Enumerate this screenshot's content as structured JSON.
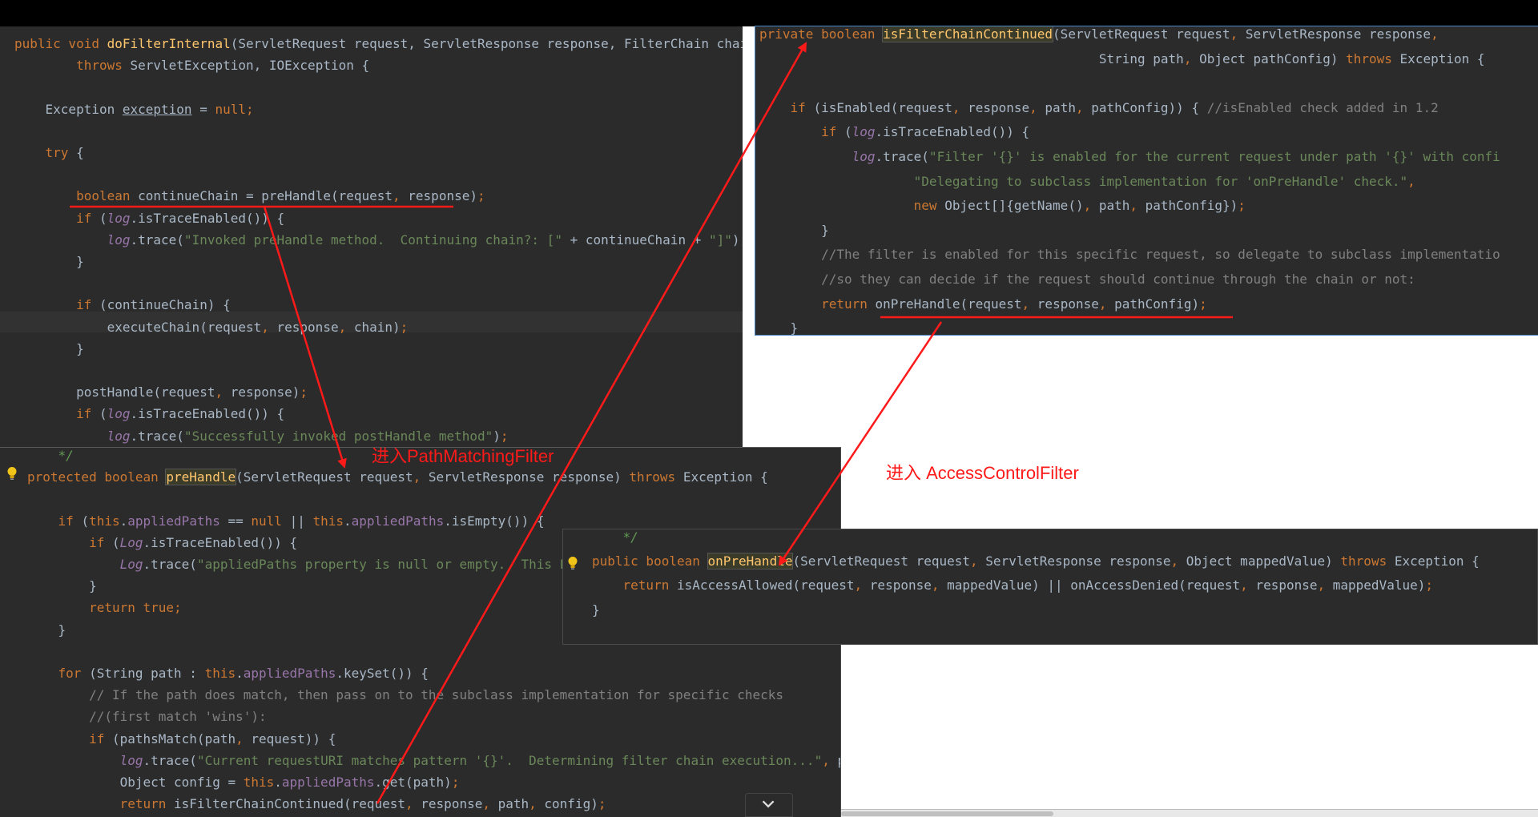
{
  "panel_a": {
    "lines": [
      [
        [
          "kw",
          "public void "
        ],
        [
          "fn",
          "doFilterInternal"
        ],
        [
          "",
          "(ServletRequest request, ServletResponse response, FilterChain chain)"
        ]
      ],
      [
        [
          "",
          "        "
        ],
        [
          "kw",
          "throws "
        ],
        [
          "",
          "ServletException, IOException {"
        ]
      ],
      [
        [
          "",
          ""
        ]
      ],
      [
        [
          "",
          "    Exception "
        ],
        [
          "u",
          "exception"
        ],
        [
          "",
          " = "
        ],
        [
          "kw",
          "null"
        ],
        [
          "kw",
          ";"
        ]
      ],
      [
        [
          "",
          ""
        ]
      ],
      [
        [
          "",
          "    "
        ],
        [
          "kw",
          "try "
        ],
        [
          "",
          "{"
        ]
      ],
      [
        [
          "",
          ""
        ]
      ],
      [
        [
          "",
          "        "
        ],
        [
          "kw",
          "boolean "
        ],
        [
          "",
          "continueChain = preHandle(request"
        ],
        [
          "kw",
          ", "
        ],
        [
          "",
          "response)"
        ],
        [
          "kw",
          ";"
        ]
      ],
      [
        [
          "",
          "        "
        ],
        [
          "kw",
          "if "
        ],
        [
          "",
          "("
        ],
        [
          "log",
          "log"
        ],
        [
          "",
          ".isTraceEnabled()) {"
        ]
      ],
      [
        [
          "",
          "            "
        ],
        [
          "log",
          "log"
        ],
        [
          "",
          ".trace("
        ],
        [
          "str",
          "\"Invoked preHandle method.  Continuing chain?: [\" "
        ],
        [
          "",
          "+ continueChain + "
        ],
        [
          "str",
          "\"]\""
        ],
        [
          "",
          ")"
        ],
        [
          "kw",
          ";"
        ]
      ],
      [
        [
          "",
          "        }"
        ]
      ],
      [
        [
          "",
          ""
        ]
      ],
      [
        [
          "",
          "        "
        ],
        [
          "kw",
          "if "
        ],
        [
          "",
          "(continueChain) {"
        ]
      ],
      [
        [
          "",
          "            executeChain(request"
        ],
        [
          "kw",
          ", "
        ],
        [
          "",
          "response"
        ],
        [
          "kw",
          ", "
        ],
        [
          "",
          "chain)"
        ],
        [
          "kw",
          ";"
        ]
      ],
      [
        [
          "",
          "        }"
        ]
      ],
      [
        [
          "",
          ""
        ]
      ],
      [
        [
          "",
          "        postHandle(request"
        ],
        [
          "kw",
          ", "
        ],
        [
          "",
          "response)"
        ],
        [
          "kw",
          ";"
        ]
      ],
      [
        [
          "",
          "        "
        ],
        [
          "kw",
          "if "
        ],
        [
          "",
          "("
        ],
        [
          "log",
          "log"
        ],
        [
          "",
          ".isTraceEnabled()) {"
        ]
      ],
      [
        [
          "",
          "            "
        ],
        [
          "log",
          "log"
        ],
        [
          "",
          ".trace("
        ],
        [
          "str",
          "\"Successfully invoked postHandle method\""
        ],
        [
          "",
          ")"
        ],
        [
          "kw",
          ";"
        ]
      ]
    ]
  },
  "panel_b": {
    "lines": [
      [
        [
          "kw",
          "private boolean "
        ],
        [
          "fnh",
          "isFilterChainContinued"
        ],
        [
          "",
          "(ServletRequest request"
        ],
        [
          "kw",
          ", "
        ],
        [
          "",
          "ServletResponse response"
        ],
        [
          "kw",
          ","
        ]
      ],
      [
        [
          "",
          "                                            String path"
        ],
        [
          "kw",
          ", "
        ],
        [
          "",
          "Object pathConfig) "
        ],
        [
          "kw",
          "throws "
        ],
        [
          "",
          "Exception {"
        ]
      ],
      [
        [
          "",
          ""
        ]
      ],
      [
        [
          "",
          "    "
        ],
        [
          "kw",
          "if "
        ],
        [
          "",
          "(isEnabled(request"
        ],
        [
          "kw",
          ", "
        ],
        [
          "",
          "response"
        ],
        [
          "kw",
          ", "
        ],
        [
          "",
          "path"
        ],
        [
          "kw",
          ", "
        ],
        [
          "",
          "pathConfig)) { "
        ],
        [
          "cm",
          "//isEnabled check added in 1.2"
        ]
      ],
      [
        [
          "",
          "        "
        ],
        [
          "kw",
          "if "
        ],
        [
          "",
          "("
        ],
        [
          "log",
          "log"
        ],
        [
          "",
          ".isTraceEnabled()) {"
        ]
      ],
      [
        [
          "",
          "            "
        ],
        [
          "log",
          "log"
        ],
        [
          "",
          ".trace("
        ],
        [
          "str",
          "\"Filter '{}' is enabled for the current request under path '{}' with confi"
        ]
      ],
      [
        [
          "",
          "                    "
        ],
        [
          "str",
          "\"Delegating to subclass implementation for 'onPreHandle' check.\""
        ],
        [
          "kw",
          ","
        ]
      ],
      [
        [
          "",
          "                    "
        ],
        [
          "kw",
          "new "
        ],
        [
          "",
          "Object[]{getName()"
        ],
        [
          "kw",
          ", "
        ],
        [
          "",
          "path"
        ],
        [
          "kw",
          ", "
        ],
        [
          "",
          "pathConfig})"
        ],
        [
          "kw",
          ";"
        ]
      ],
      [
        [
          "",
          "        }"
        ]
      ],
      [
        [
          "",
          "        "
        ],
        [
          "cm",
          "//The filter is enabled for this specific request, so delegate to subclass implementatio"
        ]
      ],
      [
        [
          "",
          "        "
        ],
        [
          "cm",
          "//so they can decide if the request should continue through the chain or not:"
        ]
      ],
      [
        [
          "",
          "        "
        ],
        [
          "kw",
          "return "
        ],
        [
          "",
          "onPreHandle(request"
        ],
        [
          "kw",
          ", "
        ],
        [
          "",
          "response"
        ],
        [
          "kw",
          ", "
        ],
        [
          "",
          "pathConfig)"
        ],
        [
          "kw",
          ";"
        ]
      ],
      [
        [
          "",
          "    }"
        ]
      ]
    ]
  },
  "panel_c": {
    "lines": [
      [
        [
          "",
          "    "
        ],
        [
          "doc",
          "*/"
        ]
      ],
      [
        [
          "kw",
          "protected boolean "
        ],
        [
          "fnh",
          "preHandle"
        ],
        [
          "",
          "(ServletRequest request"
        ],
        [
          "kw",
          ", "
        ],
        [
          "",
          "ServletResponse response) "
        ],
        [
          "kw",
          "throws "
        ],
        [
          "",
          "Exception {"
        ]
      ],
      [
        [
          "",
          ""
        ]
      ],
      [
        [
          "",
          "    "
        ],
        [
          "kw",
          "if "
        ],
        [
          "",
          "("
        ],
        [
          "kw",
          "this"
        ],
        [
          "",
          "."
        ],
        [
          "field",
          "appliedPaths "
        ],
        [
          "",
          "== "
        ],
        [
          "kw",
          "null "
        ],
        [
          "",
          "|| "
        ],
        [
          "kw",
          "this"
        ],
        [
          "",
          "."
        ],
        [
          "field",
          "appliedPaths"
        ],
        [
          "",
          ".isEmpty()) {"
        ]
      ],
      [
        [
          "",
          "        "
        ],
        [
          "kw",
          "if "
        ],
        [
          "",
          "("
        ],
        [
          "log",
          "Log"
        ],
        [
          "",
          ".isTraceEnabled()) {"
        ]
      ],
      [
        [
          "",
          "            "
        ],
        [
          "log",
          "Log"
        ],
        [
          "",
          ".trace("
        ],
        [
          "str",
          "\"appliedPaths property is null or empty.  This Filte"
        ]
      ],
      [
        [
          "",
          "        }"
        ]
      ],
      [
        [
          "",
          "        "
        ],
        [
          "kw",
          "return true"
        ],
        [
          "kw",
          ";"
        ]
      ],
      [
        [
          "",
          "    }"
        ]
      ],
      [
        [
          "",
          ""
        ]
      ],
      [
        [
          "",
          "    "
        ],
        [
          "kw",
          "for "
        ],
        [
          "",
          "(String path : "
        ],
        [
          "kw",
          "this"
        ],
        [
          "",
          "."
        ],
        [
          "field",
          "appliedPaths"
        ],
        [
          "",
          ".keySet()) {"
        ]
      ],
      [
        [
          "",
          "        "
        ],
        [
          "cm",
          "// If the path does match, then pass on to the subclass implementation for specific checks"
        ]
      ],
      [
        [
          "",
          "        "
        ],
        [
          "cm",
          "//(first match 'wins'):"
        ]
      ],
      [
        [
          "",
          "        "
        ],
        [
          "kw",
          "if "
        ],
        [
          "",
          "(pathsMatch(path"
        ],
        [
          "kw",
          ", "
        ],
        [
          "",
          "request)) {"
        ]
      ],
      [
        [
          "",
          "            "
        ],
        [
          "log",
          "log"
        ],
        [
          "",
          ".trace("
        ],
        [
          "str",
          "\"Current requestURI matches pattern '{}'.  Determining filter chain execution...\""
        ],
        [
          "kw",
          ", "
        ],
        [
          "",
          "path)"
        ],
        [
          "kw",
          ";"
        ]
      ],
      [
        [
          "",
          "            Object config = "
        ],
        [
          "kw",
          "this"
        ],
        [
          "",
          "."
        ],
        [
          "field",
          "appliedPaths"
        ],
        [
          "",
          ".get(path)"
        ],
        [
          "kw",
          ";"
        ]
      ],
      [
        [
          "",
          "            "
        ],
        [
          "kw",
          "return "
        ],
        [
          "",
          "isFilterChainContinued(request"
        ],
        [
          "kw",
          ", "
        ],
        [
          "",
          "response"
        ],
        [
          "kw",
          ", "
        ],
        [
          "",
          "path"
        ],
        [
          "kw",
          ", "
        ],
        [
          "",
          "config)"
        ],
        [
          "kw",
          ";"
        ]
      ]
    ]
  },
  "panel_d": {
    "lines": [
      [
        [
          "",
          "    "
        ],
        [
          "doc",
          "*/"
        ]
      ],
      [
        [
          "kw",
          "public boolean "
        ],
        [
          "fnh",
          "onPreHandle"
        ],
        [
          "",
          "(ServletRequest request"
        ],
        [
          "kw",
          ", "
        ],
        [
          "",
          "ServletResponse response"
        ],
        [
          "kw",
          ", "
        ],
        [
          "",
          "Object mappedValue) "
        ],
        [
          "kw",
          "throws "
        ],
        [
          "",
          "Exception {"
        ]
      ],
      [
        [
          "",
          "    "
        ],
        [
          "kw",
          "return "
        ],
        [
          "",
          "isAccessAllowed(request"
        ],
        [
          "kw",
          ", "
        ],
        [
          "",
          "response"
        ],
        [
          "kw",
          ", "
        ],
        [
          "",
          "mappedValue) || onAccessDenied(request"
        ],
        [
          "kw",
          ", "
        ],
        [
          "",
          "response"
        ],
        [
          "kw",
          ", "
        ],
        [
          "",
          "mappedValue)"
        ],
        [
          "kw",
          ";"
        ]
      ],
      [
        [
          "",
          "}"
        ]
      ]
    ]
  },
  "annotations": {
    "path_matching": "进入PathMatchingFilter",
    "access_control": "进入 AccessControlFilter"
  },
  "colors": {
    "annotation_red": "#ff1a1a",
    "editor_bg": "#2b2b2b",
    "keyword": "#cc7832",
    "string": "#6a8759",
    "comment": "#808080"
  },
  "icons": {
    "intention_bulb": "lightbulb-icon",
    "collapse": "chevron-down-icon"
  }
}
